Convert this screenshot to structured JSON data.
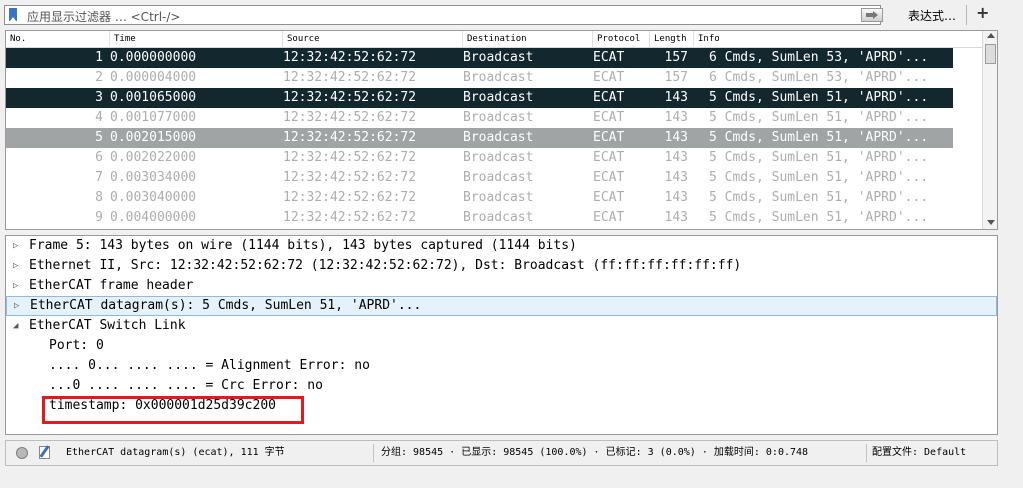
{
  "filter": {
    "placeholder": "应用显示过滤器 … <Ctrl-/>",
    "expression_label": "表达式…",
    "add_label": "+"
  },
  "columns": [
    "No.",
    "Time",
    "Source",
    "Destination",
    "Protocol",
    "Length",
    "Info"
  ],
  "packets": [
    {
      "no": "1",
      "time": "0.000000000",
      "src": "12:32:42:52:62:72",
      "dst": "Broadcast",
      "proto": "ECAT",
      "len": "157",
      "info": "6 Cmds, SumLen 53, 'APRD'...",
      "style": "dark"
    },
    {
      "no": "2",
      "time": "0.000004000",
      "src": "12:32:42:52:62:72",
      "dst": "Broadcast",
      "proto": "ECAT",
      "len": "157",
      "info": "6 Cmds, SumLen 53, 'APRD'...",
      "style": "plain"
    },
    {
      "no": "3",
      "time": "0.001065000",
      "src": "12:32:42:52:62:72",
      "dst": "Broadcast",
      "proto": "ECAT",
      "len": "143",
      "info": "5 Cmds, SumLen 51, 'APRD'...",
      "style": "dark"
    },
    {
      "no": "4",
      "time": "0.001077000",
      "src": "12:32:42:52:62:72",
      "dst": "Broadcast",
      "proto": "ECAT",
      "len": "143",
      "info": "5 Cmds, SumLen 51, 'APRD'...",
      "style": "plain"
    },
    {
      "no": "5",
      "time": "0.002015000",
      "src": "12:32:42:52:62:72",
      "dst": "Broadcast",
      "proto": "ECAT",
      "len": "143",
      "info": "5 Cmds, SumLen 51, 'APRD'...",
      "style": "grey"
    },
    {
      "no": "6",
      "time": "0.002022000",
      "src": "12:32:42:52:62:72",
      "dst": "Broadcast",
      "proto": "ECAT",
      "len": "143",
      "info": "5 Cmds, SumLen 51, 'APRD'...",
      "style": "plain"
    },
    {
      "no": "7",
      "time": "0.003034000",
      "src": "12:32:42:52:62:72",
      "dst": "Broadcast",
      "proto": "ECAT",
      "len": "143",
      "info": "5 Cmds, SumLen 51, 'APRD'...",
      "style": "plain"
    },
    {
      "no": "8",
      "time": "0.003040000",
      "src": "12:32:42:52:62:72",
      "dst": "Broadcast",
      "proto": "ECAT",
      "len": "143",
      "info": "5 Cmds, SumLen 51, 'APRD'...",
      "style": "plain"
    },
    {
      "no": "9",
      "time": "0.004000000",
      "src": "12:32:42:52:62:72",
      "dst": "Broadcast",
      "proto": "ECAT",
      "len": "143",
      "info": "5 Cmds, SumLen 51, 'APRD'...",
      "style": "plain"
    }
  ],
  "details": [
    {
      "text": "Frame 5: 143 bytes on wire (1144 bits), 143 bytes captured (1144 bits)",
      "toggle": "collapsed",
      "level": 0,
      "selected": false
    },
    {
      "text": "Ethernet II, Src: 12:32:42:52:62:72 (12:32:42:52:62:72), Dst: Broadcast (ff:ff:ff:ff:ff:ff)",
      "toggle": "collapsed",
      "level": 0,
      "selected": false
    },
    {
      "text": "EtherCAT frame header",
      "toggle": "collapsed",
      "level": 0,
      "selected": false
    },
    {
      "text": "EtherCAT datagram(s): 5 Cmds, SumLen 51, 'APRD'...",
      "toggle": "collapsed",
      "level": 0,
      "selected": true
    },
    {
      "text": "EtherCAT Switch Link",
      "toggle": "expanded",
      "level": 0,
      "selected": false
    },
    {
      "text": "Port: 0",
      "toggle": "none",
      "level": 1,
      "selected": false
    },
    {
      "text": ".... 0... .... .... = Alignment Error: no",
      "toggle": "none",
      "level": 1,
      "selected": false
    },
    {
      "text": "...0 .... .... .... = Crc Error: no",
      "toggle": "none",
      "level": 1,
      "selected": false
    },
    {
      "text": "timestamp: 0x000001d25d39c200",
      "toggle": "none",
      "level": 1,
      "selected": false
    }
  ],
  "status": {
    "field_info": "EtherCAT datagram(s) (ecat), 111 字节",
    "stats": "分组: 98545 · 已显示: 98545 (100.0%) · 已标记: 3 (0.0%) · 加载时间: 0:0.748",
    "profile": "配置文件: Default"
  },
  "colors": {
    "dark_row": "#12272e",
    "selected_row": "#a0a4a5",
    "highlight_box": "#e11b1b"
  }
}
